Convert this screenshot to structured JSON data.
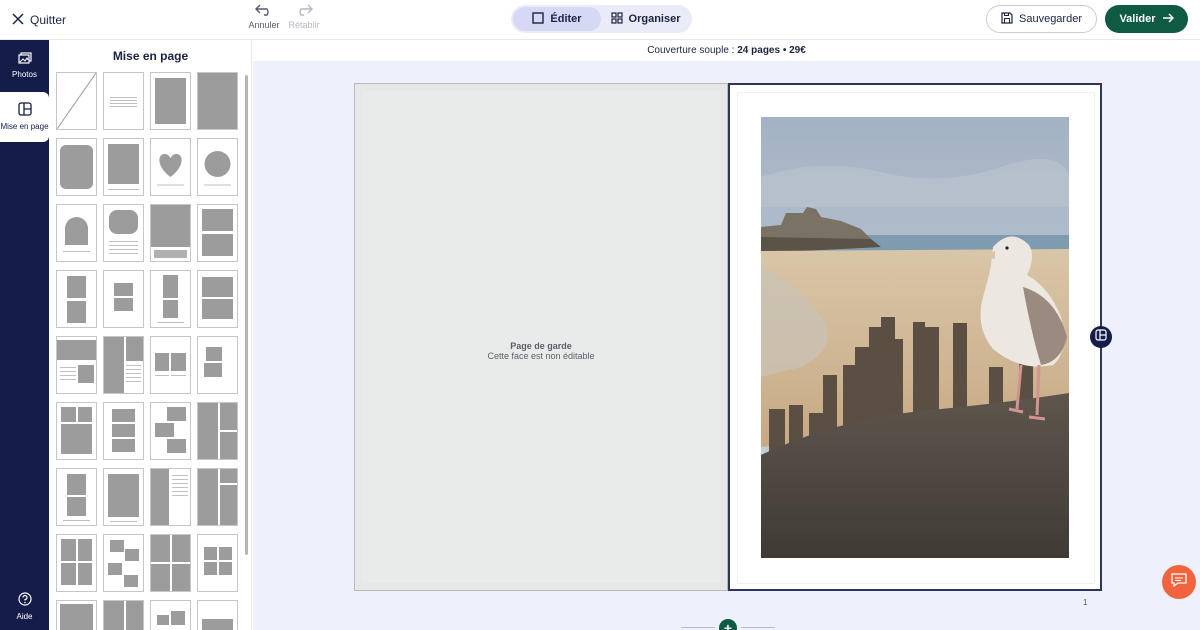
{
  "topbar": {
    "quit_label": "Quitter",
    "undo_label": "Annuler",
    "redo_label": "Rétablir",
    "modes": [
      {
        "label": "Éditer",
        "icon": "square-icon",
        "active": true
      },
      {
        "label": "Organiser",
        "icon": "grid-icon",
        "active": false
      }
    ],
    "save_label": "Sauvegarder",
    "validate_label": "Valider"
  },
  "rail": {
    "items": [
      {
        "label": "Photos",
        "icon": "photos-icon"
      },
      {
        "label": "Mise en page",
        "icon": "layout-icon",
        "active": true
      }
    ],
    "help_label": "Aide"
  },
  "panel": {
    "title": "Mise en page"
  },
  "book": {
    "cover_label": "Couverture souple : ",
    "pages_price": "24 pages • 29€"
  },
  "left_page": {
    "title": "Page de garde",
    "subtitle": "Cette face est non éditable"
  },
  "right_page": {
    "number": "1"
  },
  "colors": {
    "primary_green": "#0e5a45",
    "navy": "#141c4a",
    "canvas_bg": "#eef0fb",
    "chat_orange": "#f2643e"
  }
}
